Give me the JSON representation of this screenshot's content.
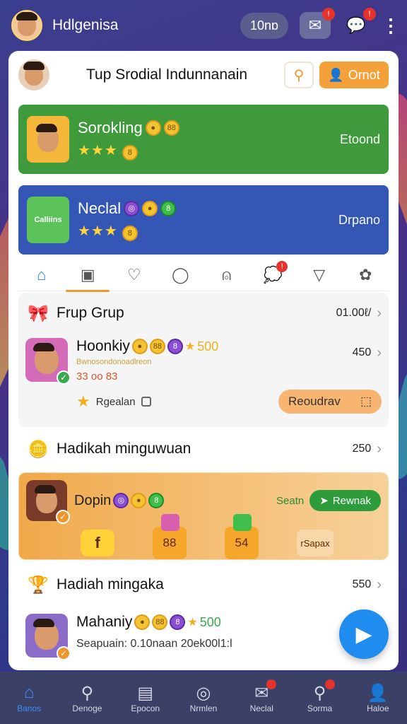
{
  "topbar": {
    "title": "Hdlgenisa",
    "pill": "10nɒ"
  },
  "header": {
    "title": "Tup Srodial Indunnanain",
    "btn": "Ornot"
  },
  "banners": [
    {
      "name": "Sorokling",
      "right": "Etoond"
    },
    {
      "name": "Neclal",
      "right": "Drpano",
      "img_text": "Calliins"
    }
  ],
  "sections": {
    "group": {
      "title": "Frup Grup",
      "value": "01.00ℓ/"
    },
    "user1": {
      "name": "Hoonkiy",
      "score": "500",
      "sub": "Bwnosondonoadlreon",
      "meta": "33 oo 83",
      "value": "450",
      "chip": "Rgealan",
      "btn": "Reoudrav"
    },
    "weekly": {
      "title": "Hadikah minguwuan",
      "value": "250"
    },
    "gold": {
      "name": "Dopin",
      "label": "Seatn",
      "reward": "Rewnak",
      "g1": "f",
      "g2": "88",
      "g3": "54",
      "g4": "rSapax"
    },
    "monthly": {
      "title": "Hadiah mingaka",
      "value": "550"
    },
    "user2": {
      "name": "Mahaniy",
      "score": "500",
      "meta": "Seapuain: 0.10naan 20ek00l1:l"
    }
  },
  "nav": [
    {
      "label": "Banos",
      "icon": "home-icon"
    },
    {
      "label": "Denoge",
      "icon": "search-icon"
    },
    {
      "label": "Epocon",
      "icon": "card-icon"
    },
    {
      "label": "Nrmlen",
      "icon": "chat-icon"
    },
    {
      "label": "Neclal",
      "icon": "message-icon"
    },
    {
      "label": "Sorma",
      "icon": "search-badge-icon"
    },
    {
      "label": "Haloe",
      "icon": "profile-icon"
    }
  ],
  "colors": {
    "accent": "#f5a13a",
    "green": "#3f9a3c",
    "blue": "#3457b5",
    "nav": "#3b4166",
    "fab": "#1f8cf0"
  }
}
